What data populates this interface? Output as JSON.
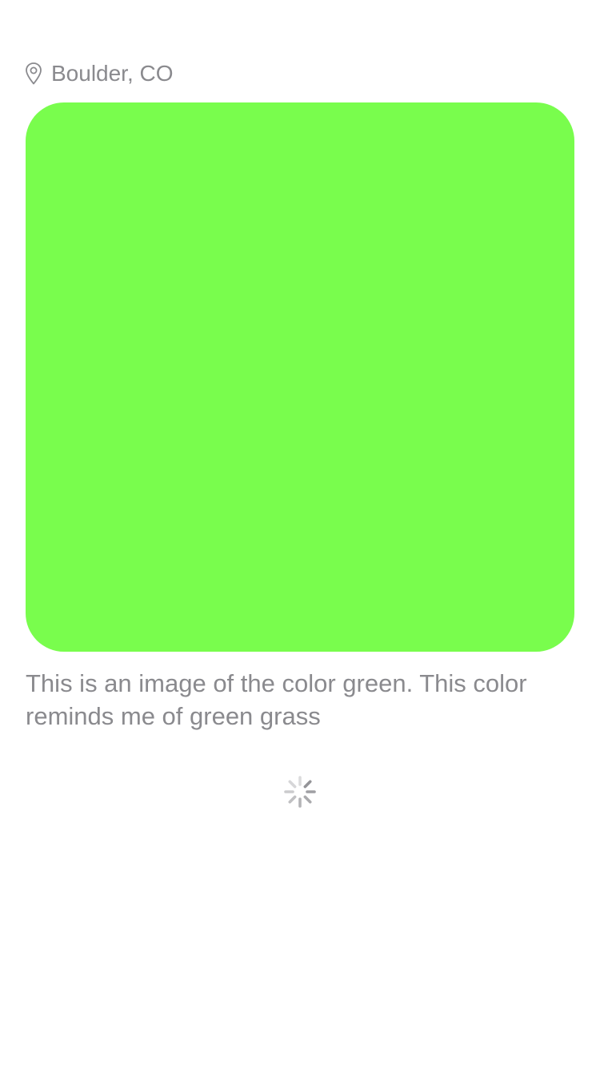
{
  "post": {
    "location": "Boulder, CO",
    "location_icon": "map-pin-icon",
    "image_color": "#79fd4d",
    "caption": "This is an image of the color green. This color reminds me of green grass"
  },
  "loading": {
    "icon": "activity-spinner-icon"
  },
  "colors": {
    "secondary_text": "#8a8a8e",
    "background": "#ffffff"
  }
}
